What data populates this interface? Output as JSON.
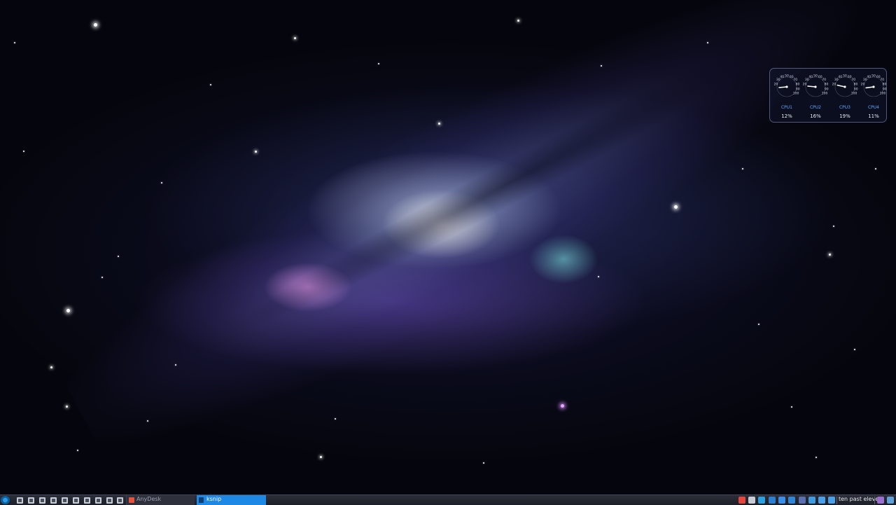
{
  "cpu_widget": {
    "gauges": [
      {
        "name": "CPU1",
        "value": "12%",
        "percent": 12
      },
      {
        "name": "CPU2",
        "value": "16%",
        "percent": 16
      },
      {
        "name": "CPU3",
        "value": "19%",
        "percent": 19
      },
      {
        "name": "CPU4",
        "value": "11%",
        "percent": 11
      }
    ],
    "scale_labels": [
      "20",
      "30",
      "40",
      "50",
      "60",
      "70",
      "80",
      "90",
      "100"
    ],
    "accent_color": "#5fa8ff"
  },
  "taskbar": {
    "app_menu_icon": "application-menu-icon",
    "launchers": [
      "desktop-icon",
      "files-icon",
      "terminal-icon",
      "browser-icon",
      "editor-icon",
      "media-icon",
      "camera-icon",
      "image-viewer-icon",
      "screenshot-icon",
      "settings-icon"
    ],
    "tasks": [
      {
        "label": "AnyDesk",
        "icon": "anydesk-icon",
        "active": false
      },
      {
        "label": "ksnip",
        "icon": "ksnip-icon",
        "active": true
      }
    ],
    "tray_icons": [
      {
        "name": "anydesk-tray-icon",
        "color": "#e8463a"
      },
      {
        "name": "ksnip-tray-icon",
        "color": "#c9ccd4"
      },
      {
        "name": "screen-icon",
        "color": "#2aa0e0"
      },
      {
        "name": "bluetooth-icon",
        "color": "#2a7fd0"
      },
      {
        "name": "network-icon",
        "color": "#3a8ee8"
      },
      {
        "name": "shield-icon",
        "color": "#2f86d6"
      },
      {
        "name": "clipboard-icon",
        "color": "#5a6fb0"
      },
      {
        "name": "update-icon",
        "color": "#3f9be0"
      },
      {
        "name": "battery-icon",
        "color": "#4aa0e8"
      },
      {
        "name": "volume-icon",
        "color": "#4aa0e8"
      }
    ],
    "clock_text": "ten past eleven",
    "end_icons": [
      {
        "name": "workspace-icon",
        "color": "#9b6fd0"
      },
      {
        "name": "show-desktop-icon",
        "color": "#5fa0d8"
      }
    ]
  }
}
